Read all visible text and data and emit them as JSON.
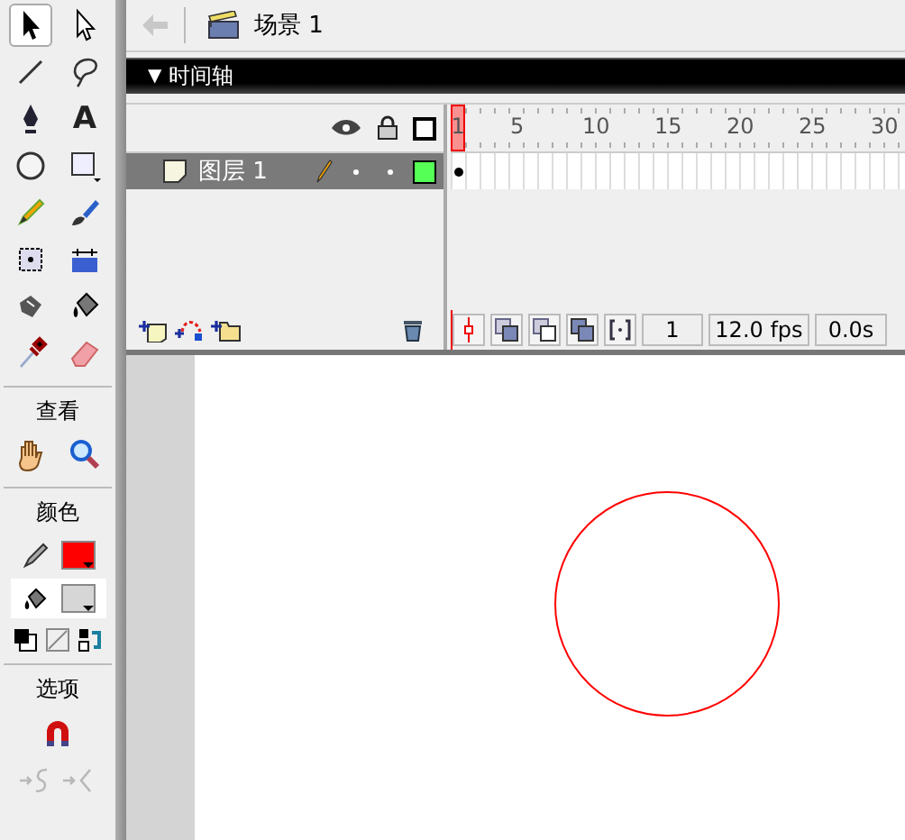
{
  "scene": {
    "label": "场景 1"
  },
  "toolbox": {
    "tools": [
      {
        "kind": "arrow",
        "selected": true
      },
      {
        "kind": "subselect",
        "selected": false
      },
      {
        "kind": "line",
        "selected": false
      },
      {
        "kind": "lasso",
        "selected": false
      },
      {
        "kind": "pen",
        "selected": false
      },
      {
        "kind": "text",
        "glyph": "A",
        "selected": false
      },
      {
        "kind": "oval",
        "selected": false
      },
      {
        "kind": "rect",
        "selected": false
      },
      {
        "kind": "pencil",
        "selected": false
      },
      {
        "kind": "brush",
        "selected": false
      },
      {
        "kind": "transform",
        "selected": false
      },
      {
        "kind": "gradient",
        "selected": false
      },
      {
        "kind": "inkbottle",
        "selected": false
      },
      {
        "kind": "bucket",
        "selected": false
      },
      {
        "kind": "dropper",
        "selected": false
      },
      {
        "kind": "eraser",
        "selected": false
      }
    ],
    "view_title": "查看",
    "view_tools": [
      {
        "kind": "hand",
        "selected": false
      },
      {
        "kind": "zoom",
        "selected": false
      }
    ],
    "colors_title": "颜色",
    "swatches": [
      {
        "kind": "stroke",
        "color": "#ff0000",
        "selected": false
      },
      {
        "kind": "fill",
        "color": "#d6d6d6",
        "selected": true
      }
    ],
    "options_title": "选项",
    "options": [
      {
        "kind": "magnet",
        "disabled": false
      },
      {
        "kind": "smooth",
        "disabled": true
      },
      {
        "kind": "straighten",
        "disabled": true
      }
    ]
  },
  "timeline": {
    "toggle": "▼",
    "title": "时间轴",
    "ruler": [
      "1",
      "5",
      "10",
      "15",
      "20",
      "25",
      "30"
    ],
    "layers": [
      {
        "name": "图层 1",
        "selected": true
      }
    ],
    "current_frame": "1",
    "fps": "12.0 fps",
    "time": "0.0s"
  }
}
